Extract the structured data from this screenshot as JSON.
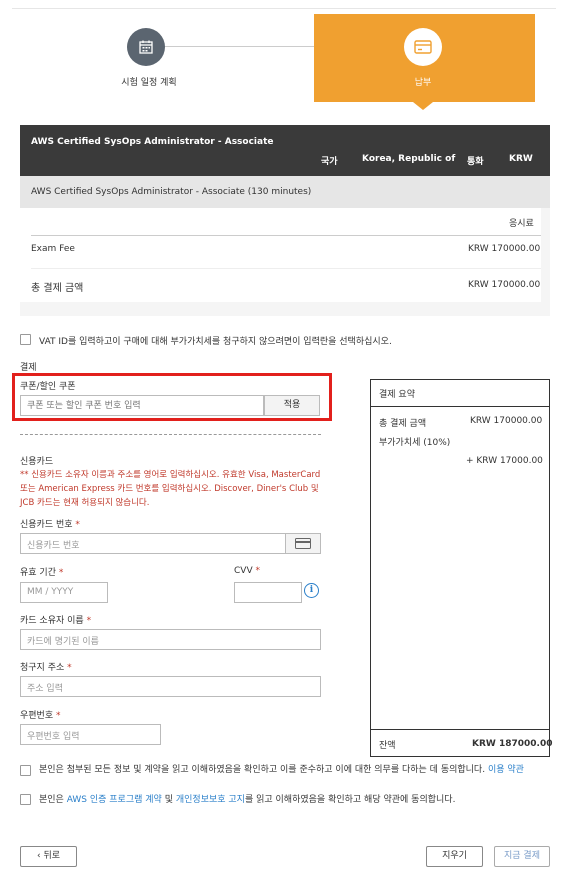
{
  "steps": {
    "step1_label": "시험 일정 계획",
    "step2_label": "납부"
  },
  "fee_table": {
    "exam_name": "AWS Certified SysOps Administrator - Associate",
    "country_label": "국가",
    "country_value": "Korea, Republic of",
    "currency_label": "통화",
    "currency_value": "KRW",
    "exam_detail": "AWS Certified SysOps Administrator - Associate (130 minutes)",
    "fee_column_label": "응시료",
    "rows": [
      {
        "label": "Exam Fee",
        "value": "KRW 170000.00"
      }
    ],
    "total_label": "총 결제 금액",
    "total_value": "KRW 170000.00"
  },
  "vat": {
    "label": "VAT ID를 입력하고이 구매에 대해 부가가치세를 청구하지 않으려면이 입력란을 선택하십시오."
  },
  "payment": {
    "section_label": "결제",
    "coupon_label": "쿠폰/할인 쿠폰",
    "coupon_placeholder": "쿠폰 또는 할인 쿠폰 번호 입력",
    "coupon_apply": "적용",
    "cc_title": "신용카드",
    "cc_note": "** 신용카드 소유자 이름과 주소를 영어로 입력하십시오. 유효한 Visa, MasterCard 또는 American Express 카드 번호를 입력하십시오. Discover, Diner's Club 및 JCB 카드는 현재 허용되지 않습니다.",
    "card_number_label": "신용카드 번호",
    "card_number_placeholder": "신용카드 번호",
    "expiry_label": "유효 기간",
    "expiry_placeholder": "MM / YYYY",
    "cvv_label": "CVV",
    "cardholder_label": "카드 소유자 이름",
    "cardholder_placeholder": "카드에 명기된 이름",
    "billing_label": "청구지 주소",
    "billing_placeholder": "주소 입력",
    "postal_label": "우편번호",
    "postal_placeholder": "우편번호 입력",
    "required_mark": "*"
  },
  "summary": {
    "title": "결제 요약",
    "total_label": "총 결제 금액",
    "total_value": "KRW 170000.00",
    "vat_label": "부가가치세 (10%)",
    "vat_value": "+ KRW 17000.00",
    "balance_label": "잔액",
    "balance_value": "KRW 187000.00"
  },
  "agreements": {
    "agree1": "본인은 첨부된 모든 정보 및 계약을 읽고 이해하였음을 확인하고 이를 준수하고 이에 대한 의무를 다하는 데 동의합니다.",
    "agree1_link": "이용 약관",
    "agree2_prefix": "본인은",
    "agree2_link1": "AWS 인증 프로그램 계약",
    "agree2_mid": "및",
    "agree2_link2": "개인정보보호 고지",
    "agree2_suffix": "를 읽고 이해하였음을 확인하고 해당 약관에 동의합니다."
  },
  "buttons": {
    "back": "‹ 뒤로",
    "clear": "지우기",
    "pay_now": "지금 결제"
  },
  "colors": {
    "accent_orange": "#f0a030",
    "highlight_red": "#e2201c",
    "dark_header": "#3a3a3a",
    "link_blue": "#2a7fc9"
  }
}
